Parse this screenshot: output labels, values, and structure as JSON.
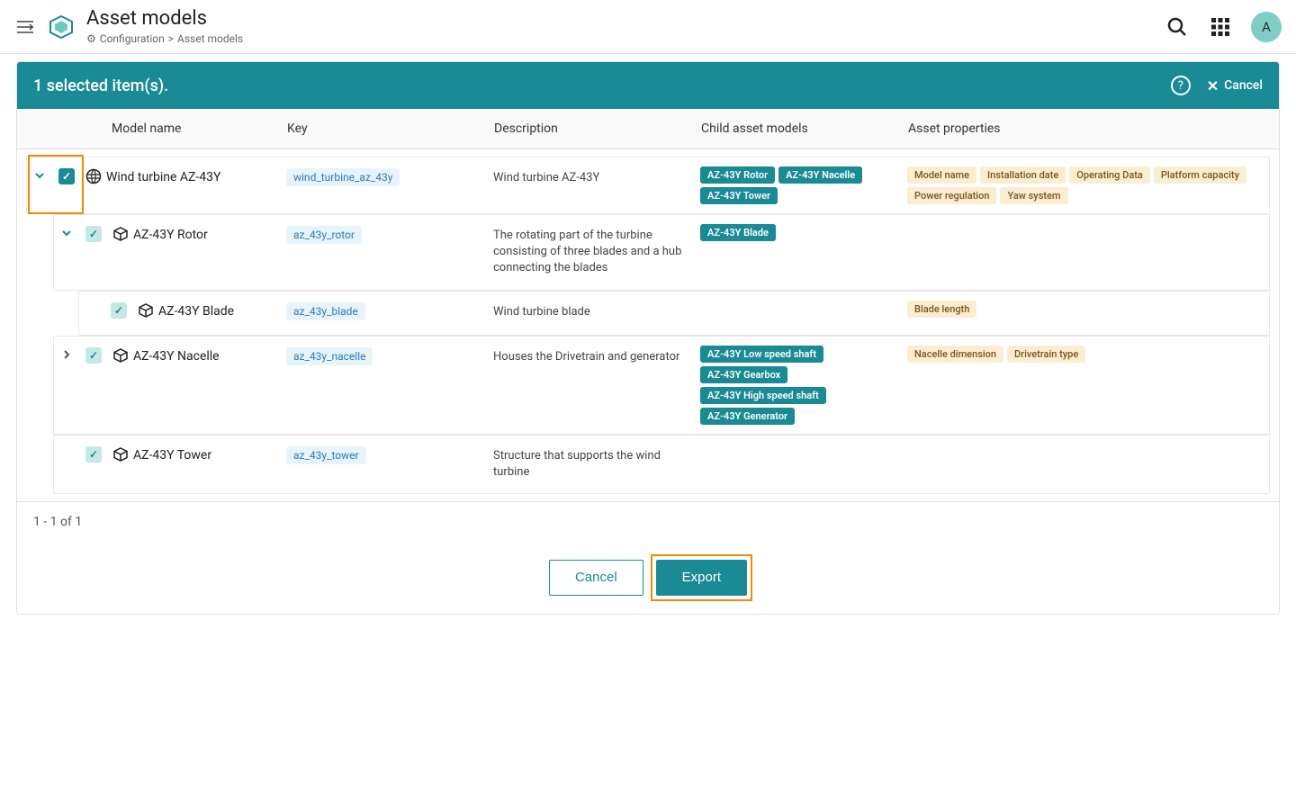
{
  "header": {
    "title": "Asset models",
    "breadcrumb": {
      "root": "Configuration",
      "sep": ">",
      "current": "Asset models"
    },
    "avatar_initial": "A"
  },
  "selection": {
    "label": "1 selected item(s).",
    "cancel": "Cancel"
  },
  "columns": {
    "name": "Model name",
    "key": "Key",
    "desc": "Description",
    "child": "Child asset models",
    "prop": "Asset properties"
  },
  "rows": [
    {
      "level": 0,
      "expandable": true,
      "expanded": true,
      "checked": true,
      "strong_check": true,
      "model_icon": "globe",
      "name": "Wind turbine AZ-43Y",
      "key": "wind_turbine_az_43y",
      "desc": "Wind turbine AZ-43Y",
      "children": [
        "AZ-43Y Rotor",
        "AZ-43Y Nacelle",
        "AZ-43Y Tower"
      ],
      "props": [
        "Model name",
        "Installation date",
        "Operating Data",
        "Platform capacity",
        "Power regulation",
        "Yaw system"
      ]
    },
    {
      "level": 1,
      "expandable": true,
      "expanded": true,
      "checked": true,
      "strong_check": false,
      "model_icon": "cube",
      "name": "AZ-43Y Rotor",
      "key": "az_43y_rotor",
      "desc": "The rotating part of the turbine consisting of three blades and a hub connecting the blades",
      "children": [
        "AZ-43Y Blade"
      ],
      "props": []
    },
    {
      "level": 2,
      "expandable": false,
      "expanded": false,
      "checked": true,
      "strong_check": false,
      "model_icon": "cube",
      "name": "AZ-43Y Blade",
      "key": "az_43y_blade",
      "desc": "Wind turbine blade",
      "children": [],
      "props": [
        "Blade length"
      ]
    },
    {
      "level": 1,
      "expandable": true,
      "expanded": false,
      "checked": true,
      "strong_check": false,
      "model_icon": "cube",
      "name": "AZ-43Y Nacelle",
      "key": "az_43y_nacelle",
      "desc": "Houses the Drivetrain and generator",
      "children": [
        "AZ-43Y Low speed shaft",
        "AZ-43Y Gearbox",
        "AZ-43Y High speed shaft",
        "AZ-43Y Generator"
      ],
      "props": [
        "Nacelle dimension",
        "Drivetrain type"
      ]
    },
    {
      "level": 1,
      "expandable": false,
      "expanded": false,
      "checked": true,
      "strong_check": false,
      "model_icon": "cube",
      "name": "AZ-43Y Tower",
      "key": "az_43y_tower",
      "desc": "Structure that supports the wind turbine",
      "children": [],
      "props": []
    }
  ],
  "pagination": {
    "text": "1 - 1 of 1"
  },
  "actions": {
    "cancel": "Cancel",
    "export": "Export"
  }
}
